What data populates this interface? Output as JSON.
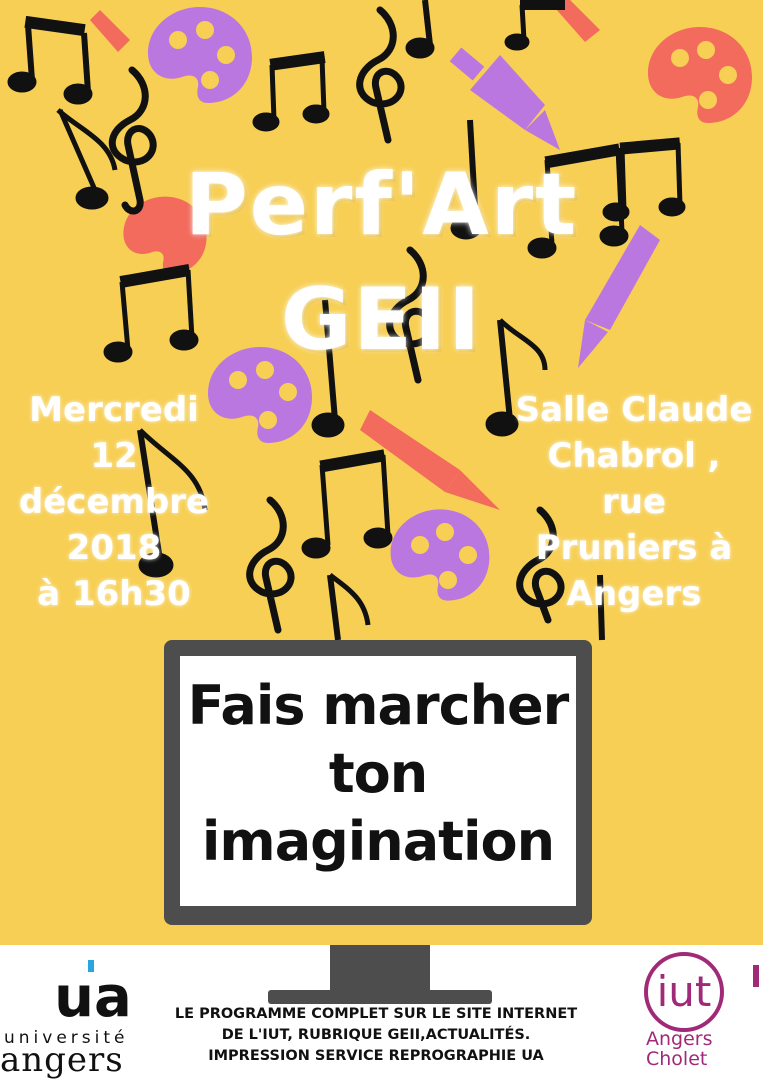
{
  "poster": {
    "title_line1": "Perf'Art",
    "title_line2": "GEII",
    "date_lines": [
      "Mercredi",
      "12",
      "décembre",
      "2018",
      "à 16h30"
    ],
    "place_lines": [
      "Salle Claude",
      "Chabrol ,",
      "rue",
      "Pruniers à",
      "Angers"
    ],
    "screen_lines": [
      "Fais marcher",
      "ton",
      "imagination"
    ]
  },
  "footer": {
    "ua_line1": "université",
    "ua_line2": "angers",
    "ua_mark": "ua",
    "info_lines": [
      "LE PROGRAMME COMPLET SUR LE SITE INTERNET",
      "DE L'IUT, RUBRIQUE GEII,ACTUALITÉS.",
      "IMPRESSION SERVICE REPROGRAPHIE UA"
    ],
    "iut_mark": "iut",
    "iut_line1": "Angers",
    "iut_line2": "Cholet"
  },
  "colors": {
    "background": "#f7cf55",
    "palette_purple": "#bb77e0",
    "palette_coral": "#f26b5c",
    "monitor": "#4d4d4d",
    "iut_brand": "#a02a78",
    "ua_accent": "#29a6e0"
  },
  "icons": [
    "music-note-icon",
    "treble-clef-icon",
    "paint-palette-icon",
    "paintbrush-icon"
  ]
}
